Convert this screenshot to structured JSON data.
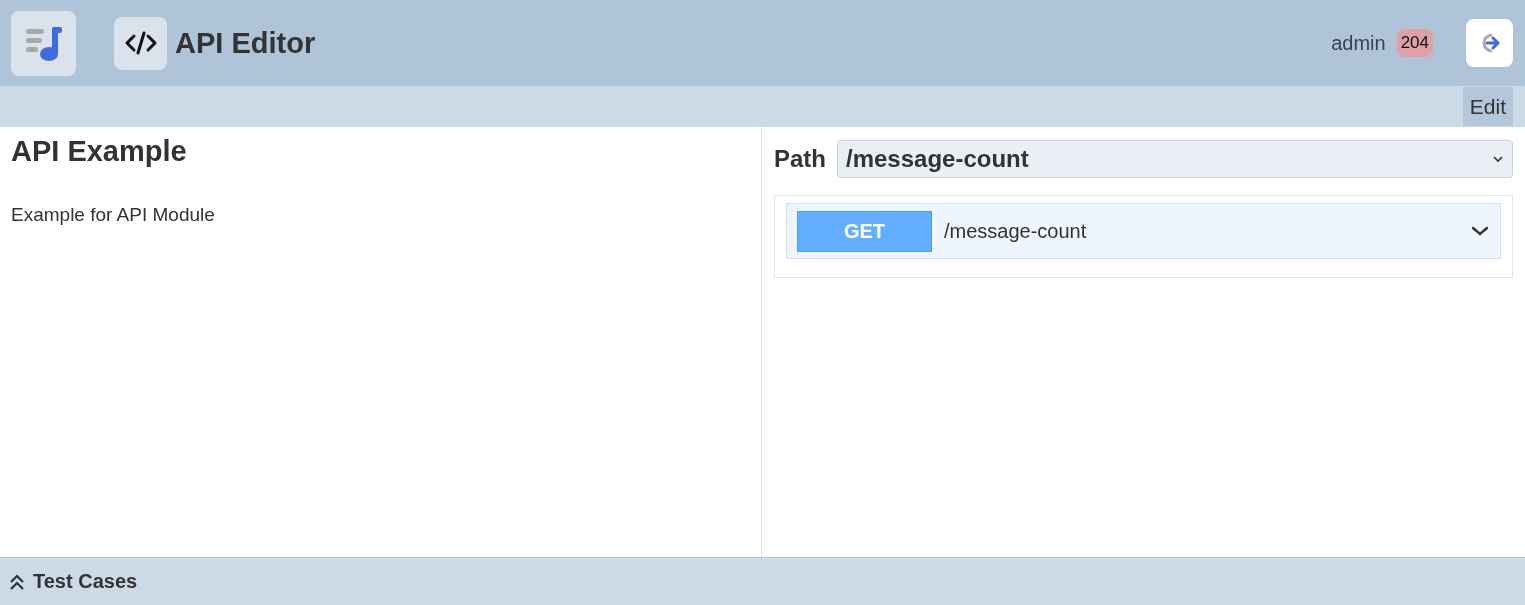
{
  "header": {
    "title": "API Editor",
    "user": "admin",
    "badge": "204"
  },
  "toolbar": {
    "buttons": [
      "Edit"
    ]
  },
  "api": {
    "title": "API Example",
    "description": "Example for API Module"
  },
  "path": {
    "label": "Path",
    "value": "/message-count"
  },
  "operations": [
    {
      "method": "GET",
      "path": "/message-count",
      "expanded": false
    }
  ],
  "footer": {
    "label": "Test Cases",
    "expanded": false
  }
}
